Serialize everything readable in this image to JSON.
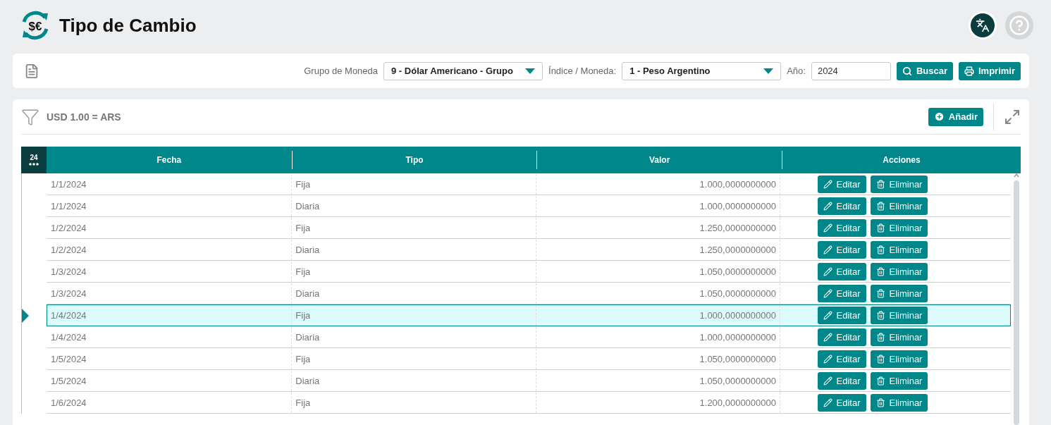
{
  "header": {
    "logo_text": "$€",
    "title": "Tipo de Cambio"
  },
  "filter_bar": {
    "fields": [
      {
        "kind": "select",
        "label": "Grupo de Moneda",
        "value": "9 - Dólar Americano - Grupo"
      },
      {
        "kind": "select",
        "label": "Índice / Moneda:",
        "value": "1 - Peso Argentino"
      },
      {
        "kind": "input",
        "label": "Año:",
        "value": "2024"
      }
    ],
    "buttons": [
      {
        "kind": "search",
        "label": "Buscar"
      },
      {
        "kind": "print",
        "label": "Imprimir"
      }
    ]
  },
  "grid": {
    "caption": "USD 1.00 = ARS",
    "add_button": "Añadir",
    "page_size": "24",
    "columns": [
      "Fecha",
      "Tipo",
      "Valor",
      "Acciones"
    ],
    "rows": [
      {
        "fecha": "1/1/2024",
        "tipo": "Fija",
        "valor": "1.000,0000000000",
        "actions": [
          "Editar",
          "Eliminar"
        ],
        "selected": false
      },
      {
        "fecha": "1/1/2024",
        "tipo": "Diaria",
        "valor": "1.000,0000000000",
        "actions": [
          "Editar",
          "Eliminar"
        ],
        "selected": false
      },
      {
        "fecha": "1/2/2024",
        "tipo": "Fija",
        "valor": "1.250,0000000000",
        "actions": [
          "Editar",
          "Eliminar"
        ],
        "selected": false
      },
      {
        "fecha": "1/2/2024",
        "tipo": "Diaria",
        "valor": "1.250,0000000000",
        "actions": [
          "Editar",
          "Eliminar"
        ],
        "selected": false
      },
      {
        "fecha": "1/3/2024",
        "tipo": "Fija",
        "valor": "1.050,0000000000",
        "actions": [
          "Editar",
          "Eliminar"
        ],
        "selected": false
      },
      {
        "fecha": "1/3/2024",
        "tipo": "Diaria",
        "valor": "1.050,0000000000",
        "actions": [
          "Editar",
          "Eliminar"
        ],
        "selected": false
      },
      {
        "fecha": "1/4/2024",
        "tipo": "Fija",
        "valor": "1.000,0000000000",
        "actions": [
          "Editar",
          "Eliminar"
        ],
        "selected": true
      },
      {
        "fecha": "1/4/2024",
        "tipo": "Diaria",
        "valor": "1.000,0000000000",
        "actions": [
          "Editar",
          "Eliminar"
        ],
        "selected": false
      },
      {
        "fecha": "1/5/2024",
        "tipo": "Fija",
        "valor": "1.050,0000000000",
        "actions": [
          "Editar",
          "Eliminar"
        ],
        "selected": false
      },
      {
        "fecha": "1/5/2024",
        "tipo": "Diaria",
        "valor": "1.050,0000000000",
        "actions": [
          "Editar",
          "Eliminar"
        ],
        "selected": false
      },
      {
        "fecha": "1/6/2024",
        "tipo": "Fija",
        "valor": "1.200,0000000000",
        "actions": [
          "Editar",
          "Eliminar"
        ],
        "selected": false
      }
    ]
  }
}
